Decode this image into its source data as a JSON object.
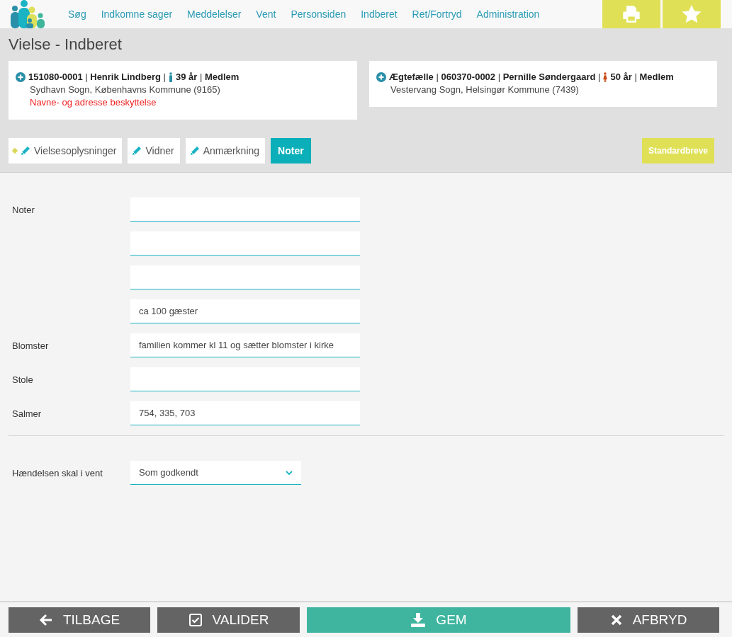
{
  "nav": {
    "items": [
      "Søg",
      "Indkomne sager",
      "Meddelelser",
      "Vent",
      "Personsiden",
      "Indberet",
      "Ret/Fortryd",
      "Administration"
    ]
  },
  "page_title": "Vielse - Indberet",
  "persons": [
    {
      "head": "**151080-0001** | **Henrik Lindberg** |",
      "kind": "man",
      "tail": "**39 år** | **Medlem**",
      "address": "Sydhavn Sogn, Københavns Kommune (9165)",
      "warning": "Navne- og adresse beskyttelse"
    },
    {
      "head": "**Ægtefælle** | **060370-0002** | **Pernille Søndergaard** |",
      "kind": "woman",
      "tail": "**50 år** | **Medlem**",
      "address": "Vestervang Sogn, Helsingør Kommune (7439)"
    }
  ],
  "tabs": [
    {
      "label": "Vielsesoplysninger",
      "kind": "edit",
      "changed": true,
      "selected": false
    },
    {
      "label": "Vidner",
      "kind": "edit",
      "changed": false,
      "selected": false
    },
    {
      "label": "Anmærkning",
      "kind": "edit",
      "changed": false,
      "selected": false
    },
    {
      "label": "Noter",
      "kind": "plain",
      "changed": false,
      "selected": true
    }
  ],
  "letters_button": "Standardbreve",
  "fields": [
    {
      "kind": "text",
      "label": "Noter"
    },
    {
      "kind": "text"
    },
    {
      "kind": "text"
    },
    {
      "kind": "text",
      "value": "ca 100 gæster"
    },
    {
      "kind": "text",
      "label": "Blomster",
      "value": "familien kommer kl 11 og sætter blomster i kirke"
    },
    {
      "kind": "text",
      "label": "Stole"
    },
    {
      "kind": "text",
      "label": "Salmer",
      "value": "754, 335, 703"
    }
  ],
  "hold": {
    "label": "Hændelsen skal i vent",
    "value": "Som godkendt"
  },
  "footer": [
    {
      "label": "TILBAGE",
      "kind": "back"
    },
    {
      "label": "VALIDER",
      "kind": "validate"
    },
    {
      "label": "GEM",
      "kind": "save"
    },
    {
      "label": "AFBRYD",
      "kind": "cancel"
    }
  ]
}
